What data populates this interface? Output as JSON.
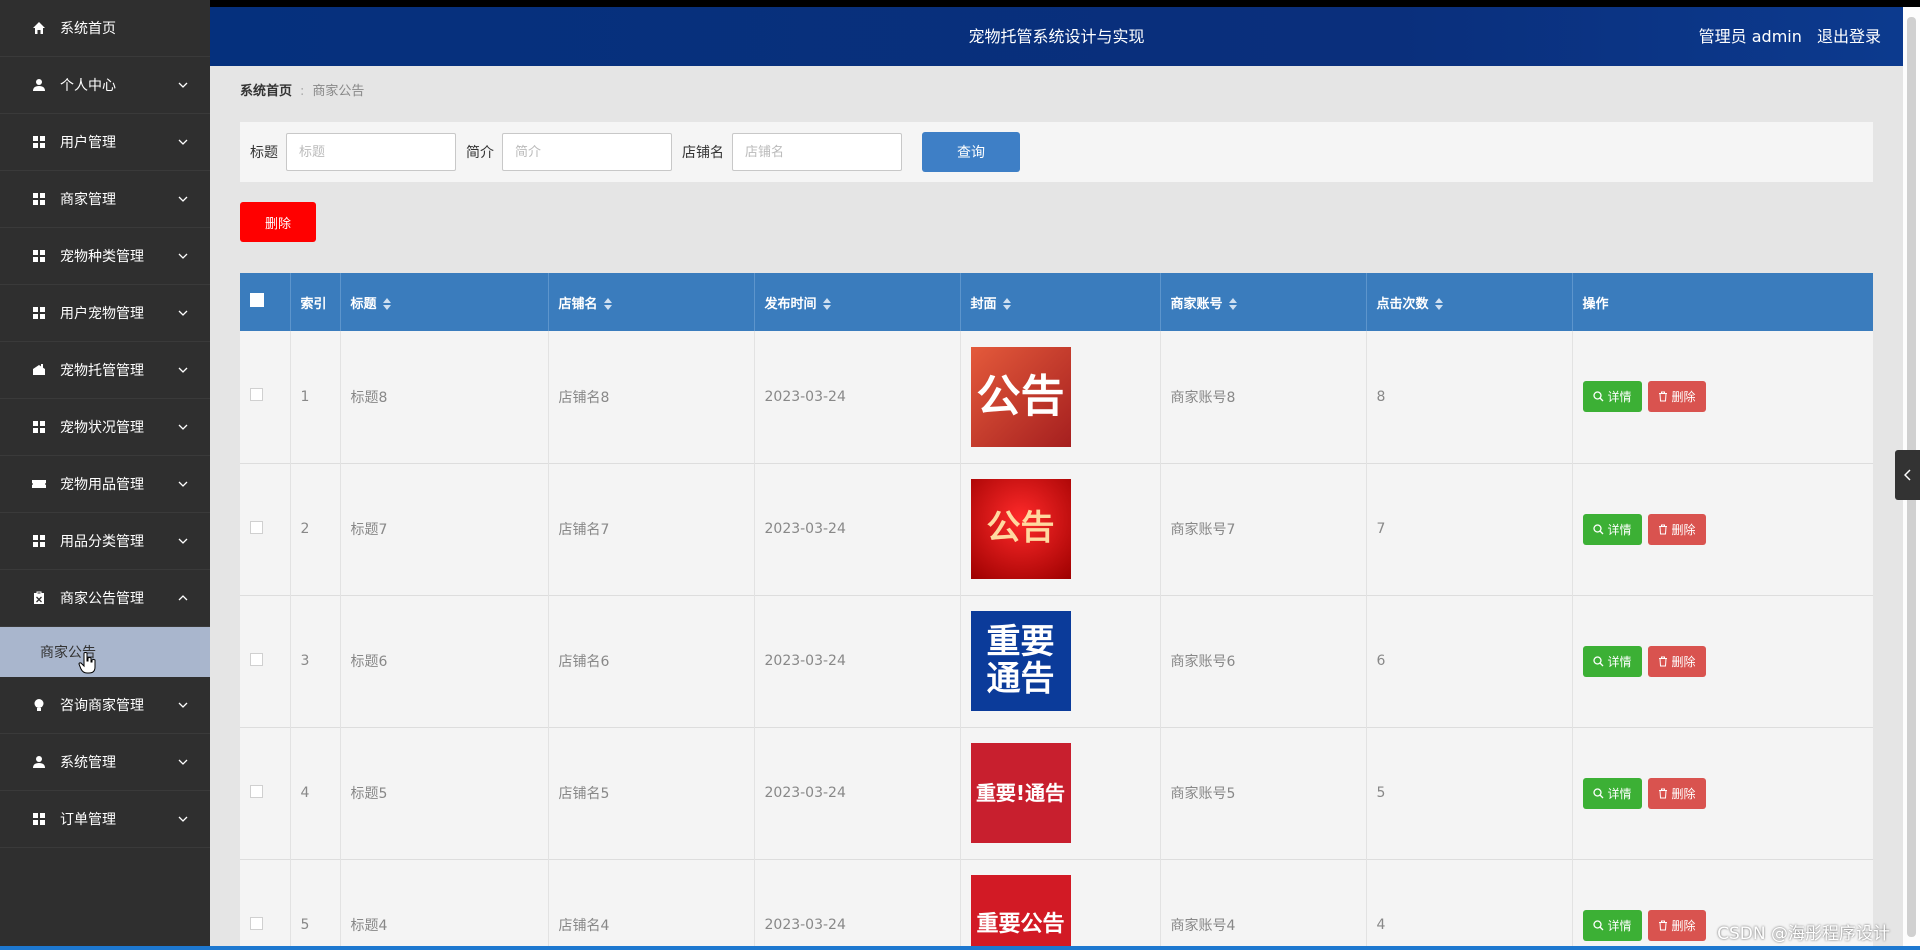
{
  "header": {
    "title": "宠物托管系统设计与实现",
    "user_label": "管理员 admin",
    "logout_label": "退出登录"
  },
  "sidebar": {
    "items": [
      {
        "label": "系统首页",
        "icon": "home-icon",
        "expandable": false
      },
      {
        "label": "个人中心",
        "icon": "user-icon",
        "expandable": true
      },
      {
        "label": "用户管理",
        "icon": "grid-icon",
        "expandable": true
      },
      {
        "label": "商家管理",
        "icon": "grid-icon",
        "expandable": true
      },
      {
        "label": "宠物种类管理",
        "icon": "grid-icon",
        "expandable": true
      },
      {
        "label": "用户宠物管理",
        "icon": "grid-icon",
        "expandable": true
      },
      {
        "label": "宠物托管管理",
        "icon": "house-icon",
        "expandable": true
      },
      {
        "label": "宠物状况管理",
        "icon": "grid-icon",
        "expandable": true
      },
      {
        "label": "宠物用品管理",
        "icon": "ticket-icon",
        "expandable": true
      },
      {
        "label": "用品分类管理",
        "icon": "grid-icon",
        "expandable": true
      },
      {
        "label": "商家公告管理",
        "icon": "clipboard-icon",
        "expandable": true,
        "expanded": true
      },
      {
        "label": "咨询商家管理",
        "icon": "bulb-icon",
        "expandable": true
      },
      {
        "label": "系统管理",
        "icon": "user-icon",
        "expandable": true
      },
      {
        "label": "订单管理",
        "icon": "grid-icon",
        "expandable": true
      }
    ],
    "active_sub": "商家公告"
  },
  "breadcrumb": {
    "home": "系统首页",
    "current": "商家公告"
  },
  "search": {
    "title_label": "标题",
    "title_placeholder": "标题",
    "intro_label": "简介",
    "intro_placeholder": "简介",
    "shop_label": "店铺名",
    "shop_placeholder": "店铺名",
    "query_label": "查询"
  },
  "batch_delete_label": "删除",
  "table": {
    "columns": [
      "索引",
      "标题",
      "店铺名",
      "发布时间",
      "封面",
      "商家账号",
      "点击次数",
      "操作"
    ],
    "rows": [
      {
        "index": "1",
        "title": "标题8",
        "shop": "店铺名8",
        "date": "2023-03-24",
        "cover_text": [
          "公告"
        ],
        "account": "商家账号8",
        "clicks": "8"
      },
      {
        "index": "2",
        "title": "标题7",
        "shop": "店铺名7",
        "date": "2023-03-24",
        "cover_text": [
          "公告"
        ],
        "account": "商家账号7",
        "clicks": "7"
      },
      {
        "index": "3",
        "title": "标题6",
        "shop": "店铺名6",
        "date": "2023-03-24",
        "cover_text": [
          "重要",
          "通告"
        ],
        "account": "商家账号6",
        "clicks": "6"
      },
      {
        "index": "4",
        "title": "标题5",
        "shop": "店铺名5",
        "date": "2023-03-24",
        "cover_text": [
          "重要!通告"
        ],
        "account": "商家账号5",
        "clicks": "5"
      },
      {
        "index": "5",
        "title": "标题4",
        "shop": "店铺名4",
        "date": "2023-03-24",
        "cover_text": [
          "重要公告"
        ],
        "account": "商家账号4",
        "clicks": "4"
      }
    ],
    "detail_label": "详情",
    "delete_label": "删除"
  },
  "watermark": "CSDN @海彤程序设计",
  "colors": {
    "header": "#05307d",
    "sidebar": "#2f2f2f",
    "table_header": "#3a7cbd",
    "detail_button": "#3cb035",
    "delete_button": "#d9534f",
    "batch_delete": "#ff0000",
    "query_button": "#3e7fc6"
  }
}
